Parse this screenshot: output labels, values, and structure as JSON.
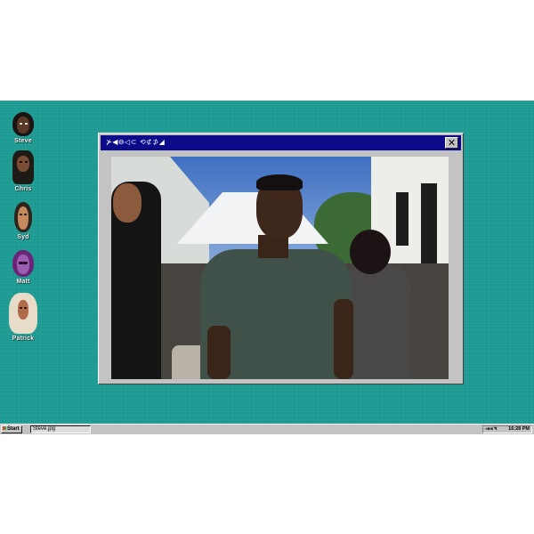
{
  "desktop": {
    "icons": [
      {
        "label": "Steve",
        "icon": "steve-avatar-icon",
        "bg": "#2a2a2a",
        "skin": "#5a3a27"
      },
      {
        "label": "Chris",
        "icon": "chris-avatar-icon",
        "bg": "#1e1a16",
        "skin": "#7a4e32"
      },
      {
        "label": "Syd",
        "icon": "syd-avatar-icon",
        "bg": "#3a2c22",
        "skin": "#c48a5e"
      },
      {
        "label": "Matt",
        "icon": "matt-avatar-icon",
        "bg": "#7a2a8a",
        "skin": "#9a5fb0"
      },
      {
        "label": "Patrick",
        "icon": "patrick-avatar-icon",
        "bg": "#e6dcc8",
        "skin": "#b06a4a"
      }
    ]
  },
  "window": {
    "title_glyphs": "⊁◀⊖◁⊂  ⟲⊄⊅◢",
    "close_label": "✕",
    "image": "steve-photo"
  },
  "taskbar": {
    "start_label": "Start",
    "task_label": "Steve.jpg",
    "tray_icons": "◂▪▪◥",
    "clock": "16:28 PM"
  },
  "colors": {
    "desktop": "#1c9c93",
    "titlebar": "#0b0b8a",
    "chrome": "#c3c3c3"
  }
}
